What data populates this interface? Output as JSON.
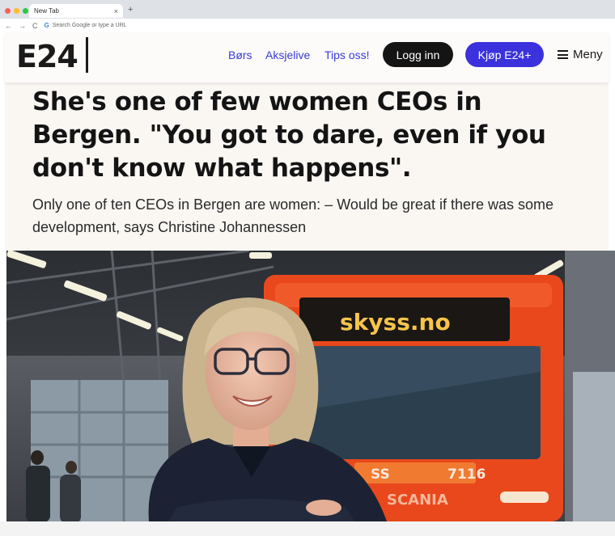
{
  "browser": {
    "tab_title": "New Tab",
    "tab_close": "×",
    "new_tab": "+",
    "back": "←",
    "forward": "→",
    "reload": "C",
    "omnibox_placeholder": "Search Google or type a URL",
    "google_g": "G",
    "traffic_colors": [
      "#ff5f57",
      "#febc2e",
      "#28c840"
    ]
  },
  "site": {
    "logo": "E24",
    "nav": [
      "Børs",
      "Aksjelive",
      "Tips oss!"
    ],
    "login_label": "Logg inn",
    "buy_label": "Kjøp E24+",
    "menu_label": "Meny",
    "accent_color": "#3b32dd"
  },
  "article": {
    "headline": "She's one of few women CEOs in Bergen. \"You got to dare, even if you don't know what happens\".",
    "standfirst": "Only one of ten CEOs in Bergen are women: – Would be great if there was some development, says Christine Johannessen",
    "photo": {
      "bus_sign": "skyss.no",
      "bus_number": "7116",
      "bus_brand": "SCANIA",
      "bus_side": "SS"
    }
  }
}
